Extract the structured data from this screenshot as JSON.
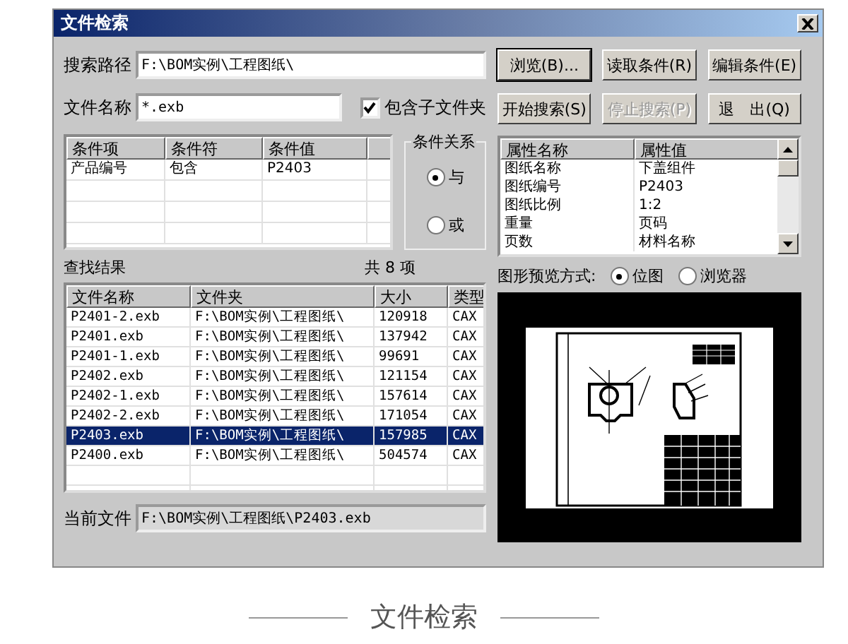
{
  "window": {
    "title": "文件检索"
  },
  "search_path": {
    "label": "搜索路径",
    "value": "F:\\BOM实例\\工程图纸\\"
  },
  "file_name": {
    "label": "文件名称",
    "value": "*.exb"
  },
  "include_subfolders": {
    "label": "包含子文件夹",
    "checked": true
  },
  "buttons": [
    {
      "label": "浏览(B)...",
      "disabled": false
    },
    {
      "label": "读取条件(R)",
      "disabled": false
    },
    {
      "label": "编辑条件(E)",
      "disabled": false
    },
    {
      "label": "开始搜索(S)",
      "disabled": false
    },
    {
      "label": "停止搜索(P)",
      "disabled": true
    },
    {
      "label": "退　出(Q)",
      "disabled": false
    }
  ],
  "conditions": {
    "columns": [
      "条件项",
      "条件符",
      "条件值"
    ],
    "rows": [
      [
        "产品编号",
        "包含",
        "P2403"
      ]
    ]
  },
  "condition_relation": {
    "title": "条件关系",
    "options": [
      {
        "label": "与",
        "selected": true
      },
      {
        "label": "或",
        "selected": false
      }
    ]
  },
  "properties": {
    "columns": [
      "属性名称",
      "属性值"
    ],
    "rows": [
      [
        "图纸名称",
        "下盖组件"
      ],
      [
        "图纸编号",
        "P2403"
      ],
      [
        "图纸比例",
        "1:2"
      ],
      [
        "重量",
        "页码"
      ],
      [
        "页数",
        "材料名称"
      ]
    ]
  },
  "results": {
    "label": "查找结果",
    "count": "共 8 项",
    "columns": [
      "文件名称",
      "文件夹",
      "大小",
      "类型"
    ],
    "rows": [
      {
        "cells": [
          "P2401-2.exb",
          "F:\\BOM实例\\工程图纸\\",
          "120918",
          "CAX"
        ],
        "selected": false
      },
      {
        "cells": [
          "P2401.exb",
          "F:\\BOM实例\\工程图纸\\",
          "137942",
          "CAX"
        ],
        "selected": false
      },
      {
        "cells": [
          "P2401-1.exb",
          "F:\\BOM实例\\工程图纸\\",
          "99691",
          "CAX"
        ],
        "selected": false
      },
      {
        "cells": [
          "P2402.exb",
          "F:\\BOM实例\\工程图纸\\",
          "121154",
          "CAX"
        ],
        "selected": false
      },
      {
        "cells": [
          "P2402-1.exb",
          "F:\\BOM实例\\工程图纸\\",
          "157614",
          "CAX"
        ],
        "selected": false
      },
      {
        "cells": [
          "P2402-2.exb",
          "F:\\BOM实例\\工程图纸\\",
          "171054",
          "CAX"
        ],
        "selected": false
      },
      {
        "cells": [
          "P2403.exb",
          "F:\\BOM实例\\工程图纸\\",
          "157985",
          "CAX"
        ],
        "selected": true
      },
      {
        "cells": [
          "P2400.exb",
          "F:\\BOM实例\\工程图纸\\",
          "504574",
          "CAX"
        ],
        "selected": false
      }
    ]
  },
  "preview_mode": {
    "label": "图形预览方式:",
    "options": [
      {
        "label": "位图",
        "selected": true
      },
      {
        "label": "浏览器",
        "selected": false
      }
    ]
  },
  "current_file": {
    "label": "当前文件",
    "value": "F:\\BOM实例\\工程图纸\\P2403.exb"
  },
  "caption": "文件检索"
}
